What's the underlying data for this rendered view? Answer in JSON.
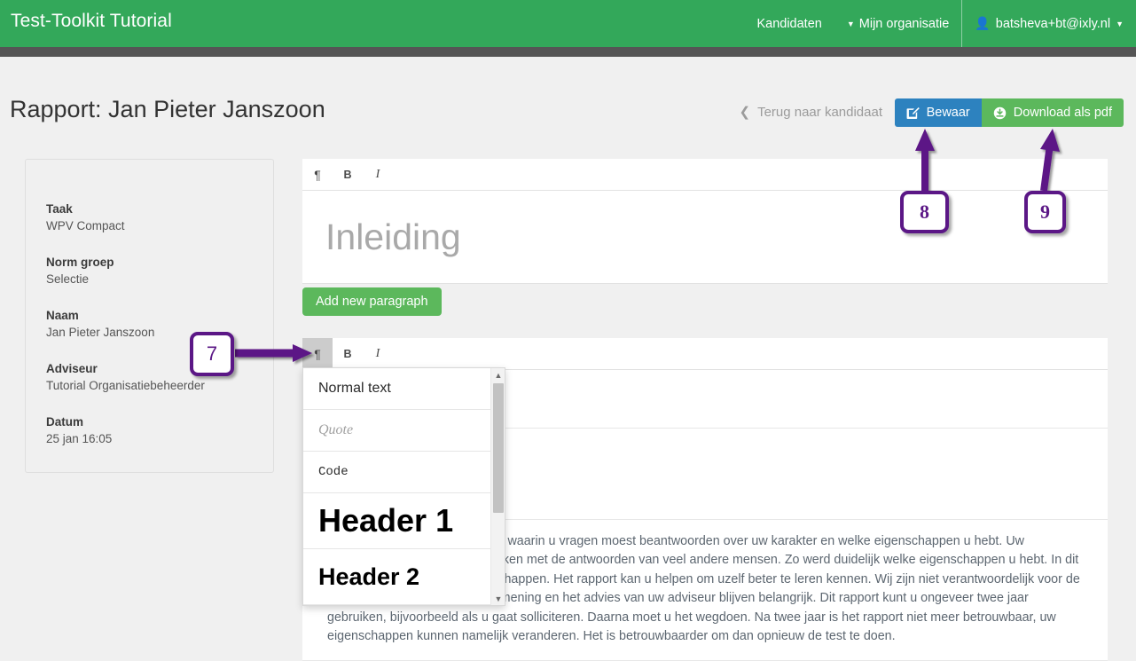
{
  "navbar": {
    "brand": "Test-Toolkit Tutorial",
    "items": [
      {
        "label": "Kandidaten",
        "icon": "none"
      },
      {
        "label": "Mijn organisatie",
        "icon": "caret-down-icon"
      }
    ],
    "user": {
      "label": "batsheva+bt@ixly.nl",
      "icon": "user-icon",
      "caret": "caret-down-icon"
    }
  },
  "header": {
    "title": "Rapport: Jan Pieter Janszoon",
    "back_link": "Terug naar kandidaat",
    "back_icon": "chevron-left-icon",
    "save_label": "Bewaar",
    "save_icon": "edit-pencil-icon",
    "pdf_label": "Download als pdf",
    "pdf_icon": "download-circle-icon"
  },
  "info_panel": {
    "groups": [
      {
        "label": "Taak",
        "value": "WPV Compact"
      },
      {
        "label": "Norm groep",
        "value": "Selectie"
      },
      {
        "label": "Naam",
        "value": "Jan Pieter Janszoon"
      },
      {
        "label": "Adviseur",
        "value": "Tutorial Organisatiebeheerder"
      },
      {
        "label": "Datum",
        "value": "25 jan 16:05"
      }
    ]
  },
  "editor": {
    "toolbar": {
      "paragraph_icon": "pilcrow-icon",
      "bold_icon": "bold-icon",
      "italic_icon": "italic-icon"
    },
    "heading_value": "Inleiding",
    "add_paragraph_label": "Add new paragraph",
    "paragraph_text": "U heeft een vragenlijst ingevuld waarin u vragen moest beantwoorden over uw karakter en welke eigenschappen u hebt. Uw antwoorden hebben wij vergeleken met de antwoorden van veel andere mensen. Zo werd duidelijk welke eigenschappen u hebt. In dit rapport leest u over die eigenschappen. Het rapport kan u helpen om uzelf beter te leren kennen. Wij zijn niet verantwoordelijk voor de uitkomsten, uw eigen kritische mening en het advies van uw adviseur blijven belangrijk. Dit rapport kunt u ongeveer twee jaar gebruiken, bijvoorbeeld als u gaat solliciteren. Daarna moet u het wegdoen. Na twee jaar is het rapport niet meer betrouwbaar, uw eigenschappen kunnen namelijk veranderen. Het is betrouwbaarder om dan opnieuw de test te doen."
  },
  "dropdown": {
    "items": [
      {
        "label": "Normal text",
        "style": "normal"
      },
      {
        "label": "Quote",
        "style": "quote"
      },
      {
        "label": "Code",
        "style": "code"
      },
      {
        "label": "Header 1",
        "style": "h1"
      },
      {
        "label": "Header 2",
        "style": "h2"
      }
    ],
    "scroll_up_icon": "triangle-up-icon",
    "scroll_down_icon": "triangle-down-icon"
  },
  "annotations": [
    {
      "number": "7"
    },
    {
      "number": "8"
    },
    {
      "number": "9"
    }
  ],
  "colors": {
    "brand_green": "#33a85a",
    "subbar_gray": "#555555",
    "save_blue": "#2d82bf",
    "pdf_green": "#5cb85c",
    "annotation_purple": "#5b1786",
    "page_bg": "#f0f0f0"
  }
}
